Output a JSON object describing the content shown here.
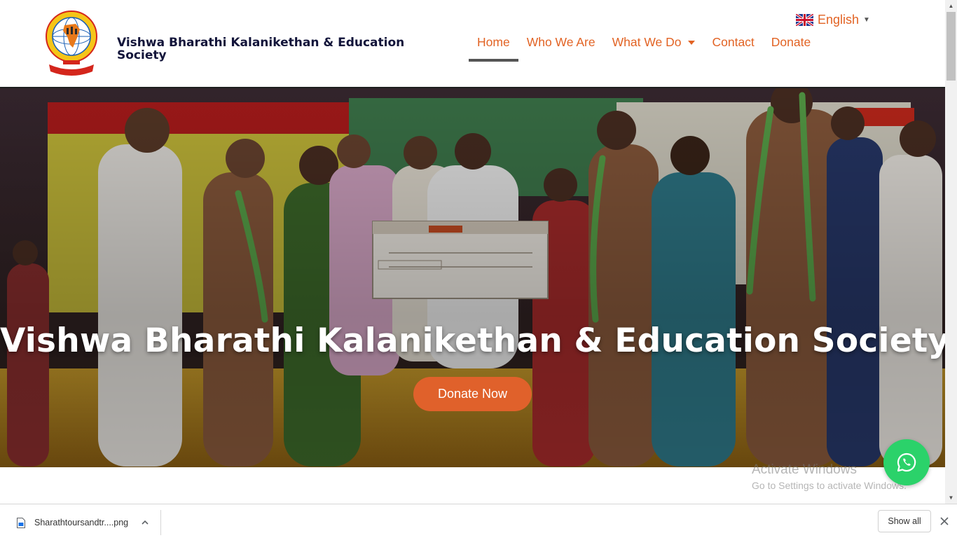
{
  "header": {
    "site_title": "Vishwa Bharathi Kalanikethan & Education Society",
    "logo_icon": "organization-seal-logo",
    "language": {
      "label": "English",
      "flag_icon": "uk-flag-icon"
    }
  },
  "nav": {
    "items": [
      {
        "label": "Home",
        "active": true
      },
      {
        "label": "Who We Are"
      },
      {
        "label": "What We Do",
        "has_dropdown": true
      },
      {
        "label": "Contact"
      },
      {
        "label": "Donate"
      }
    ]
  },
  "hero": {
    "title": "Vishwa Bharathi Kalanikethan & Education Society",
    "cta_label": "Donate Now"
  },
  "watermark": {
    "title": "Activate Windows",
    "subtitle": "Go to Settings to activate Windows."
  },
  "floating": {
    "whatsapp_icon": "whatsapp-icon"
  },
  "download_bar": {
    "file_name": "Sharathtoursandtr....png",
    "show_all_label": "Show all"
  },
  "colors": {
    "accent": "#e26324",
    "title_dark": "#12143a",
    "cta": "#e0612b",
    "whatsapp": "#2bd26a"
  }
}
